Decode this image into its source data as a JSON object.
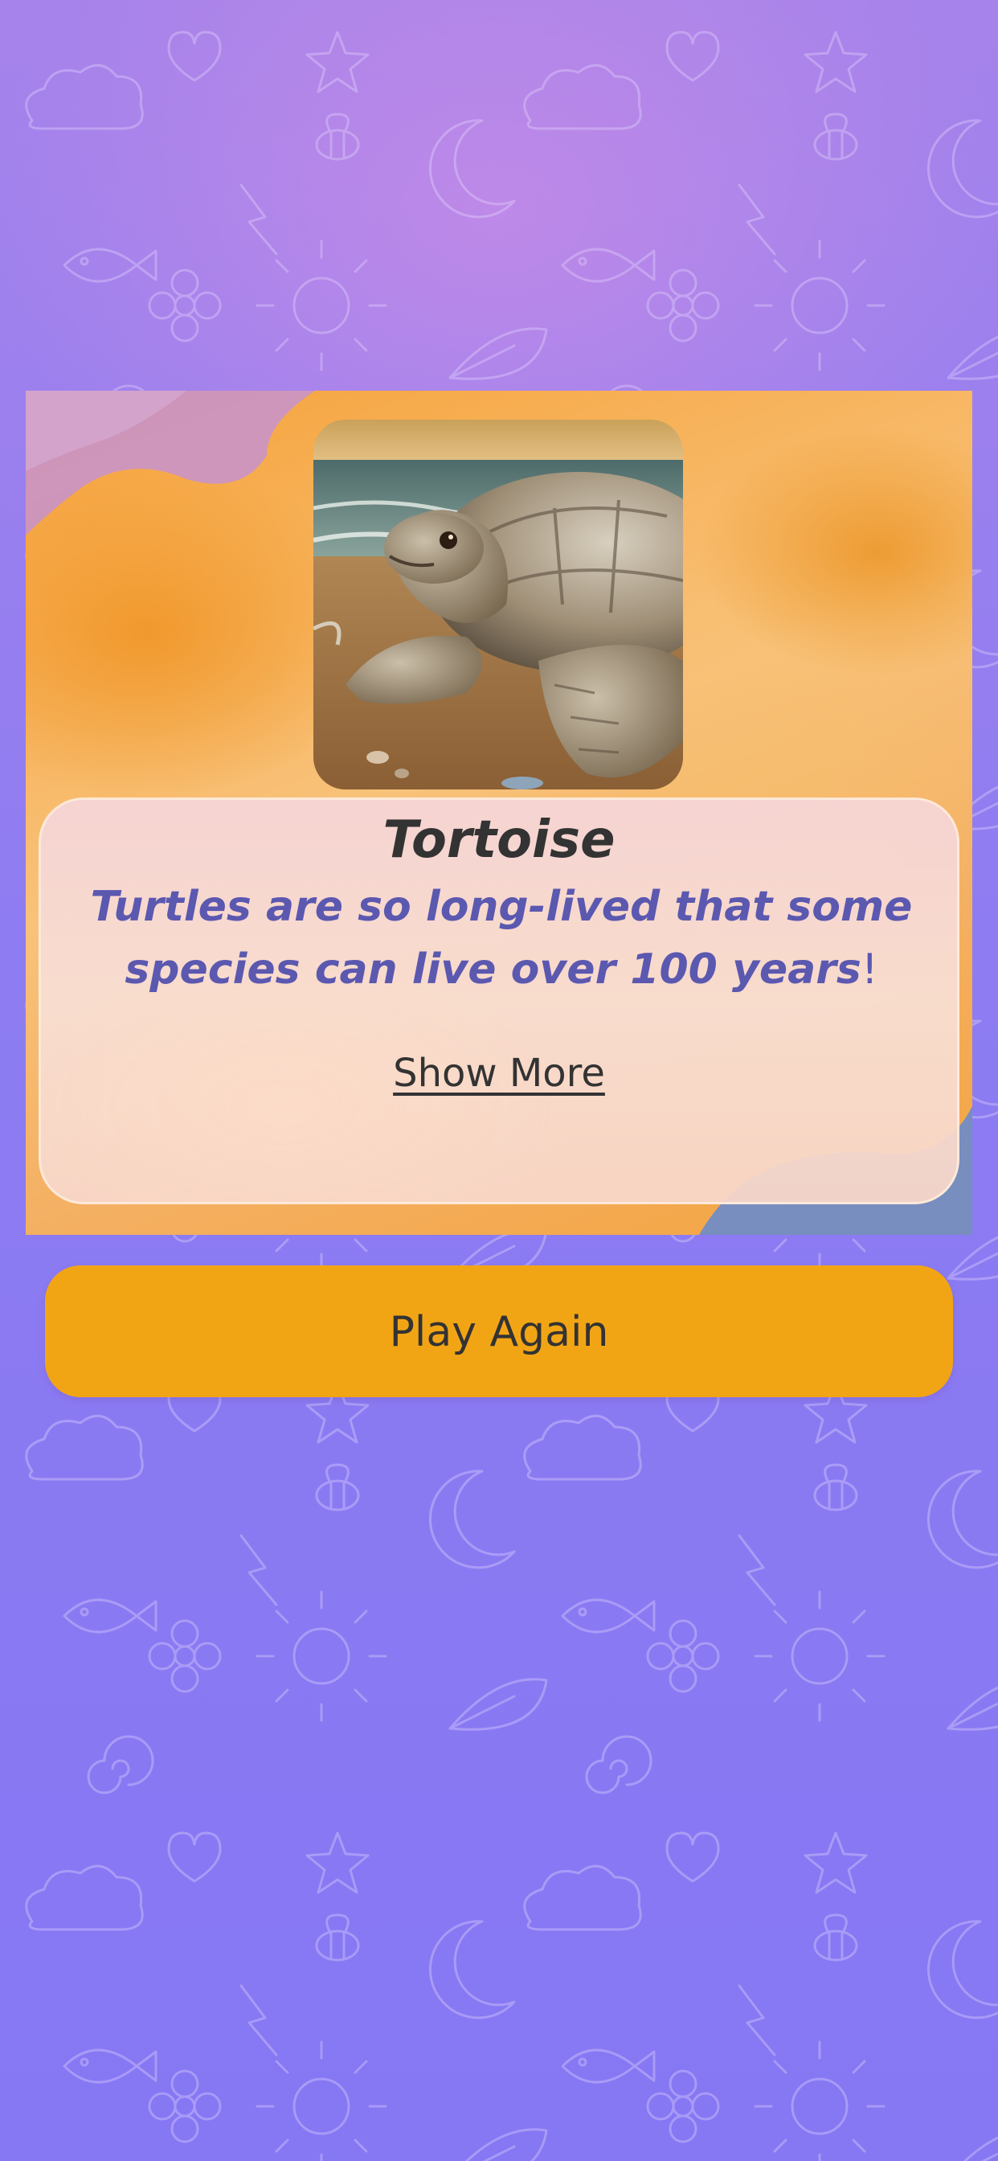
{
  "card": {
    "photo_alt": "Tortoise",
    "title": "Tortoise",
    "fact_text": "Turtles are so long-lived that some species can live over 100 years",
    "fact_punct": "!",
    "show_more": "Show More"
  },
  "actions": {
    "play_again": "Play Again"
  },
  "colors": {
    "background": "#8b7cf0",
    "card_orange": "#f6a23a",
    "fact_text": "#5b58b0",
    "title_text": "#333333",
    "play_again_button": "#f2a514"
  }
}
